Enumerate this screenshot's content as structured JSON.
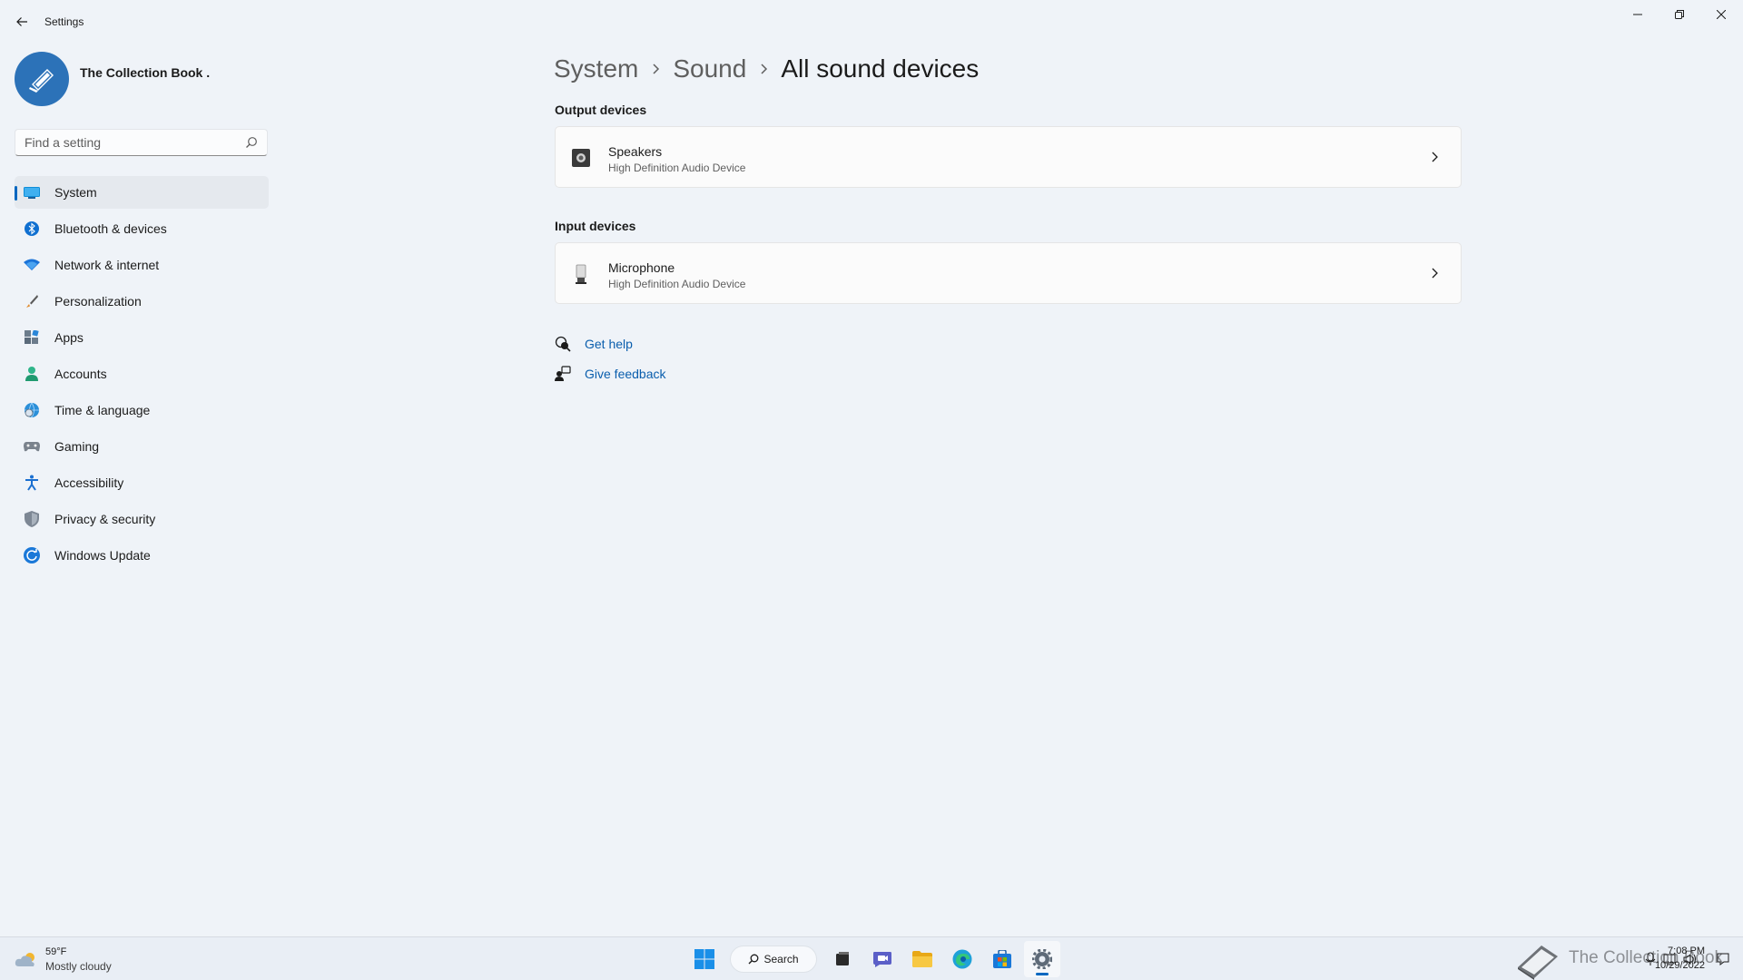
{
  "app": {
    "title": "Settings",
    "profile_name": "The Collection Book ."
  },
  "search": {
    "placeholder": "Find a setting",
    "value": ""
  },
  "sidebar": {
    "selected": "System",
    "items": [
      {
        "label": "System",
        "icon": "monitor-icon"
      },
      {
        "label": "Bluetooth & devices",
        "icon": "bluetooth-icon"
      },
      {
        "label": "Network & internet",
        "icon": "wifi-icon"
      },
      {
        "label": "Personalization",
        "icon": "brush-icon"
      },
      {
        "label": "Apps",
        "icon": "apps-icon"
      },
      {
        "label": "Accounts",
        "icon": "person-icon"
      },
      {
        "label": "Time & language",
        "icon": "globe-clock-icon"
      },
      {
        "label": "Gaming",
        "icon": "gamepad-icon"
      },
      {
        "label": "Accessibility",
        "icon": "accessibility-icon"
      },
      {
        "label": "Privacy & security",
        "icon": "shield-icon"
      },
      {
        "label": "Windows Update",
        "icon": "update-icon"
      }
    ]
  },
  "breadcrumb": {
    "items": [
      "System",
      "Sound",
      "All sound devices"
    ]
  },
  "output_section": {
    "title": "Output devices",
    "devices": [
      {
        "name": "Speakers",
        "subtitle": "High Definition Audio Device",
        "icon": "speaker-icon"
      }
    ]
  },
  "input_section": {
    "title": "Input devices",
    "devices": [
      {
        "name": "Microphone",
        "subtitle": "High Definition Audio Device",
        "icon": "microphone-icon"
      }
    ]
  },
  "help": {
    "get_help": "Get help",
    "give_feedback": "Give feedback"
  },
  "taskbar": {
    "weather_temp": "59°F",
    "weather_condition": "Mostly cloudy",
    "search_label": "Search",
    "watermark": "The Collection Book",
    "time": "7:08 PM",
    "date": "10/29/2022"
  },
  "colors": {
    "accent": "#0067c0",
    "link": "#0a5ead",
    "background": "#eff3f8",
    "avatar": "#2c72b8"
  }
}
